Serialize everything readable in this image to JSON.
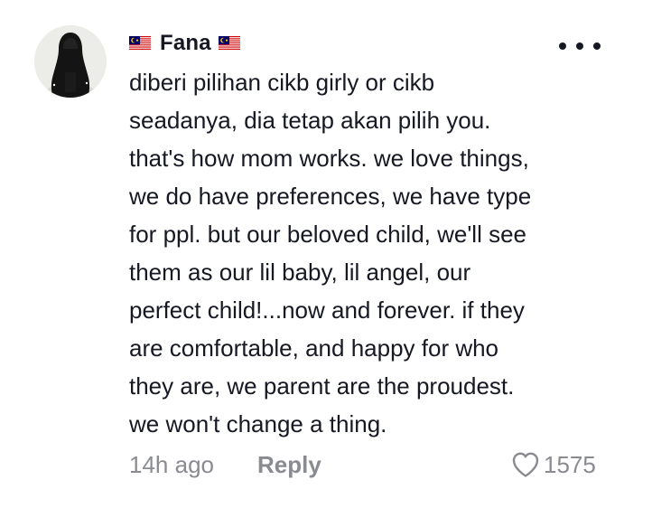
{
  "comment": {
    "avatar": "avatar-image",
    "username": "Fana",
    "flag_icon": "malaysia-flag-icon",
    "text_lines": [
      "diberi pilihan cikb girly or cikb",
      "seadanya, dia tetap akan pilih you.",
      "that's how mom works. we love things,",
      "we do have preferences, we have type",
      "for ppl. but our beloved child, we'll see",
      "them as our lil baby, lil angel, our",
      "perfect child!...now and forever. if they",
      "are comfortable, and happy for who",
      "they are, we parent are the proudest.",
      "we won't change a thing."
    ],
    "timestamp": "14h ago",
    "reply_label": "Reply",
    "like_icon": "heart-icon",
    "like_count": "1575",
    "more_icon": "more-options-icon"
  },
  "colors": {
    "text": "#161823",
    "muted": "#8a8b91",
    "background": "#ffffff"
  }
}
